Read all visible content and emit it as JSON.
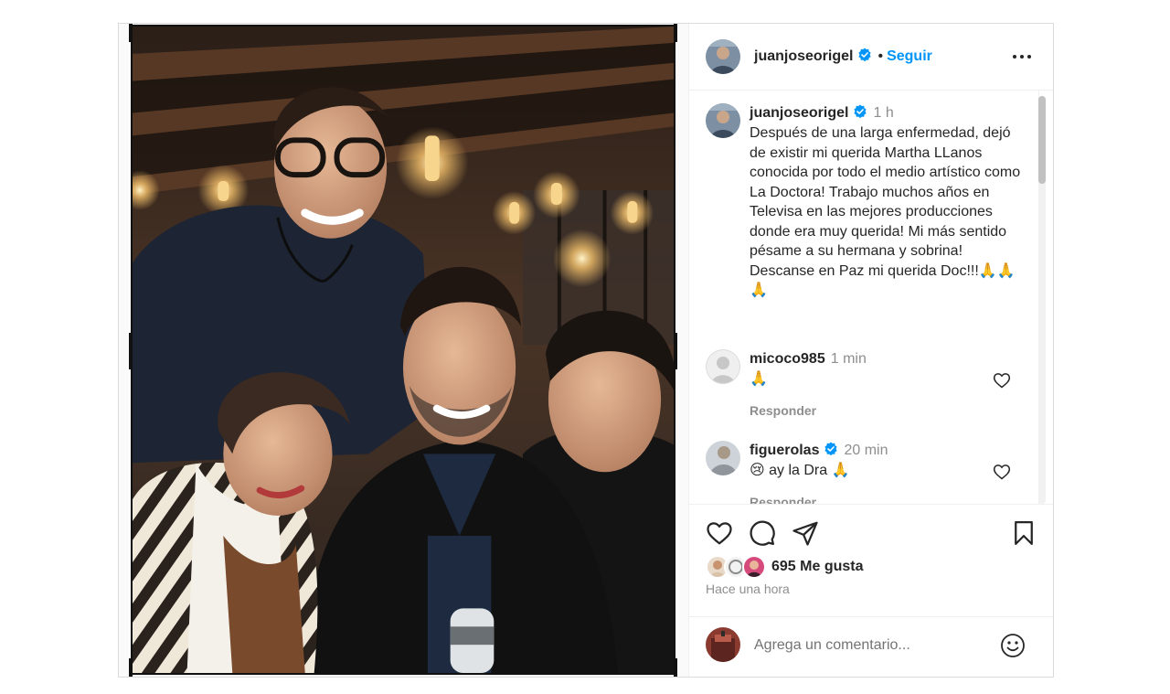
{
  "post": {
    "author": "juanjoseorigel",
    "follow_label": "Seguir",
    "dot": "•",
    "caption": {
      "author": "juanjoseorigel",
      "time": "1 h",
      "text": "Después de una larga enfermedad, dejó de existir mi querida Martha LLanos conocida por todo el medio artístico como La Doctora! Trabajo muchos años en Televisa en las mejores producciones donde era muy querida! Mi más sentido pésame a su hermana y sobrina! Descanse en Paz mi querida Doc!!!🙏🙏🙏"
    },
    "comments": [
      {
        "author": "micoco985",
        "time": "1 min",
        "text": "🙏",
        "reply_label": "Responder",
        "verified": false
      },
      {
        "author": "figuerolas",
        "time": "20 min",
        "text": "😢 ay la Dra 🙏",
        "reply_label": "Responder",
        "verified": true
      }
    ],
    "likes": "695 Me gusta",
    "time_ago": "Hace una hora",
    "comment_placeholder": "Agrega un comentario..."
  },
  "icons": {
    "more": "more-dots-icon",
    "like": "heart-icon",
    "comment": "comment-bubble-icon",
    "share": "paper-plane-icon",
    "save": "bookmark-icon",
    "emoji": "smiley-icon",
    "verified": "verified-badge-icon"
  },
  "colors": {
    "link": "#0095f6",
    "verified": "#0095f6",
    "muted": "#8e8e8e",
    "text": "#262626"
  }
}
